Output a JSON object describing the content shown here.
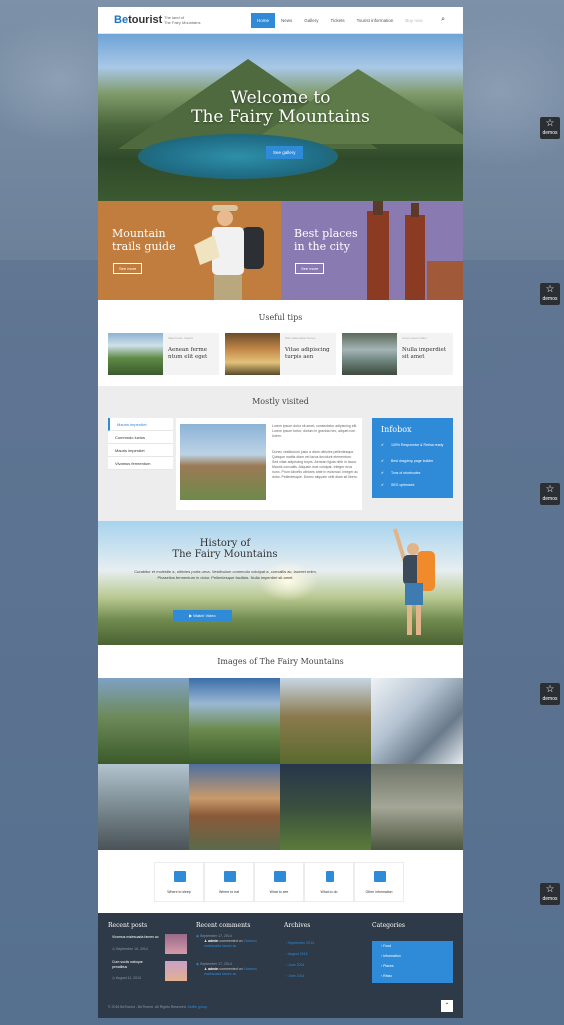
{
  "logo": {
    "be": "Be",
    "tourist": "tourist",
    "tagline_1": "The land of",
    "tagline_2": "The Fairy Mountains"
  },
  "nav": [
    "Home",
    "News",
    "Gallery",
    "Tickets",
    "Tourist information",
    "Buy now"
  ],
  "hero": {
    "title_1": "Welcome to",
    "title_2": "The Fairy Mountains",
    "button": "See gallery"
  },
  "promo": [
    {
      "title_1": "Mountain",
      "title_2": "trails guide",
      "button": "See more"
    },
    {
      "title_1": "Best places",
      "title_2": "in the city",
      "button": "See more"
    }
  ],
  "useful_tips": {
    "title": "Useful tips",
    "items": [
      {
        "meta": "Aliqu lorem mauris",
        "title_1": "Aenean ferme",
        "title_2": "ntum elit eget"
      },
      {
        "meta": "Nisl malesuada Tumes",
        "title_1": "Vitae adipiscing",
        "title_2": "turpis aen"
      },
      {
        "meta": "Lorem ipsum dolor",
        "title_1": "Nulla imperdiet",
        "title_2": "sit amet"
      }
    ]
  },
  "mostly_visited": {
    "title": "Mostly visited",
    "tabs": [
      "Mauris imperdiet",
      "Commodo luctus",
      "Mauris imperdiet",
      "Vivamus fermentum"
    ],
    "para_1": "Lorem ipsum dolor sit amet, consectetur adipiscing elit. Lorem ipsum tortor, dictum in gravida nec, aliquet non lorem.",
    "para_2": "Donec vestibulum justo a diam ultricies pellentesque. Quisque mattis diam vel lacus tincidunt elementum. Sed vitae adipiscing turpis. Aenean ligula nibh in lacus. Mauris convallis. Aliquam erat volutpat. Integer eros nunc. Proin lobortis ultricies ante in euismod. Integer ac dolor. Pellentesque. Donec aliquam velit diam sit libero."
  },
  "infobox": {
    "title": "Infobox",
    "items": [
      "100% Responsive & Retina ready",
      "Best dragdrop page builder",
      "Tons of shortcodes",
      "SEO optimized"
    ]
  },
  "history": {
    "title_1": "History of",
    "title_2": "The Fairy Mountains",
    "text": "Curabitur et molestie a, ultricies porta urna. Vestibulum commodo volutpat a, convallis ac, laoreet enim. Phasellus fermentum in dolor. Pellentesque facilisis. Nulla imperdiet sit amet.",
    "button": "Watch Video"
  },
  "gallery": {
    "title": "Images of The Fairy Mountains"
  },
  "icons": [
    "Where to sleep",
    "Where to eat",
    "What to see",
    "What to do",
    "Other information"
  ],
  "footer": {
    "recent_posts": {
      "title": "Recent posts",
      "items": [
        {
          "title_1": "Vivamus malesuada fames ac",
          "date": "September 16, 2014"
        },
        {
          "title_1": "Cum sociis natoque",
          "title_2": "penatibus",
          "date": "August 11, 2014"
        }
      ]
    },
    "recent_comments": {
      "title": "Recent comments",
      "items": [
        {
          "date": "September 17, 2014",
          "author": "admin",
          "rest": " commented on ",
          "link": "Vivamus malesuada fames ac"
        },
        {
          "date": "September 17, 2014",
          "author": "admin",
          "rest": " commented on ",
          "link": "Vivamus malesuada fames ac"
        }
      ]
    },
    "archives": {
      "title": "Archives",
      "items": [
        "September 2014",
        "August 2014",
        "June 2014",
        "June 2014"
      ]
    },
    "categories": {
      "title": "Categories",
      "items": [
        "Food",
        "Information",
        "Places",
        "Relax"
      ]
    },
    "copyright": "© 2016 BeTourist - BeTheme. All Rights Reserved. ",
    "copyright_link": "Muffin group"
  },
  "demos_label": "demos"
}
